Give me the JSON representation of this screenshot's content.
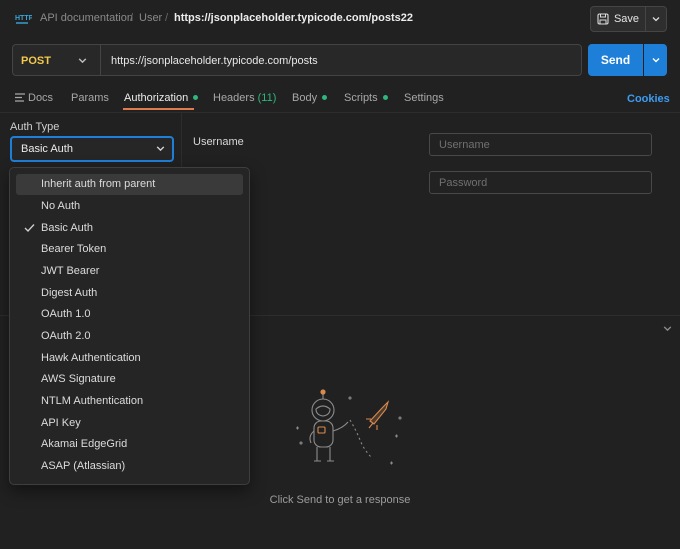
{
  "breadcrumb": {
    "items": [
      "API documentation",
      "User"
    ],
    "separator": "/",
    "current": "https://jsonplaceholder.typicode.com/posts22"
  },
  "toolbar": {
    "save_label": "Save"
  },
  "request": {
    "method": "POST",
    "url": "https://jsonplaceholder.typicode.com/posts",
    "send_label": "Send"
  },
  "tabs": [
    {
      "label": "Docs",
      "icon": "docs-icon"
    },
    {
      "label": "Params"
    },
    {
      "label": "Authorization",
      "active": true,
      "status_dot": true
    },
    {
      "label": "Headers",
      "count": "(11)"
    },
    {
      "label": "Body",
      "status_dot": true
    },
    {
      "label": "Scripts",
      "status_dot": true
    },
    {
      "label": "Settings"
    }
  ],
  "cookies_label": "Cookies",
  "auth": {
    "type_label": "Auth Type",
    "selected": "Basic Auth",
    "username_label": "Username",
    "username_placeholder": "Username",
    "password_placeholder": "Password"
  },
  "auth_menu": {
    "items": [
      "Inherit auth from parent",
      "No Auth",
      "Basic Auth",
      "Bearer Token",
      "JWT Bearer",
      "Digest Auth",
      "OAuth 1.0",
      "OAuth 2.0",
      "Hawk Authentication",
      "AWS Signature",
      "NTLM Authentication",
      "API Key",
      "Akamai EdgeGrid",
      "ASAP (Atlassian)"
    ],
    "checked_index": 2,
    "hover_index": 0
  },
  "response": {
    "empty_message": "Click Send to get a response"
  },
  "colors": {
    "accent": "#1e7fd8",
    "method": "#f2c94c",
    "active_tab": "#e07a4f",
    "status_dot": "#2fb67c"
  }
}
